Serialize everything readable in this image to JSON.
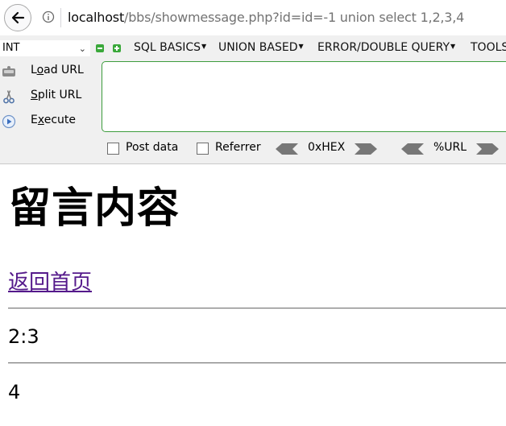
{
  "address_bar": {
    "url_host": "localhost",
    "url_path": "/bbs/showmessage.php?id=id=-1 union select 1,2,3,4"
  },
  "hackbar": {
    "type_select": "INT",
    "menus": [
      "SQL BASICS",
      "UNION BASED",
      "ERROR/DOUBLE QUERY",
      "TOOLS"
    ],
    "load_url": {
      "prefix": "L",
      "accel": "o",
      "rest": "ad URL"
    },
    "split_url": {
      "prefix": "",
      "accel": "S",
      "rest": "plit URL"
    },
    "execute": {
      "prefix": "E",
      "accel": "x",
      "rest": "ecute"
    },
    "post_data_label": "Post data",
    "referrer_label": "Referrer",
    "hex_label": "0xHEX",
    "url_label": "%URL"
  },
  "page": {
    "title": "留言内容",
    "home_link": "返回首页",
    "line1": "2:3",
    "line2": "4"
  }
}
